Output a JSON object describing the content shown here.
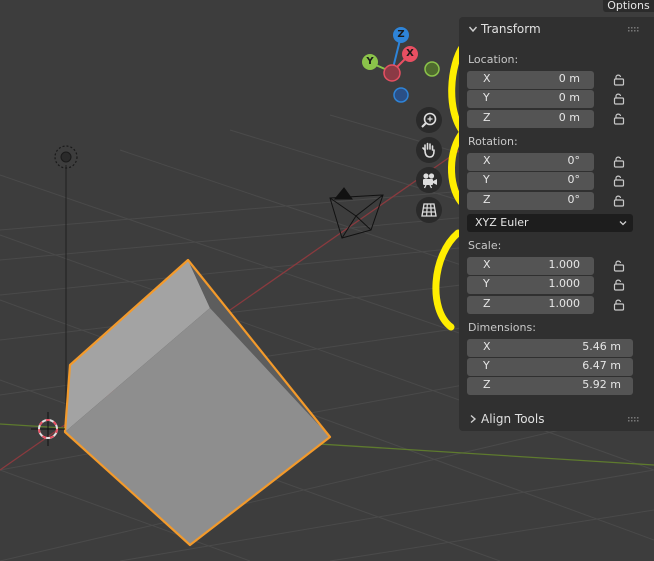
{
  "topbar": {
    "options_label": "Options"
  },
  "gizmo": {
    "x": "X",
    "y": "Y",
    "z": "Z"
  },
  "panel": {
    "transform": {
      "title": "Transform",
      "location": {
        "label": "Location:",
        "x_axis": "X",
        "x": "0 m",
        "y_axis": "Y",
        "y": "0 m",
        "z_axis": "Z",
        "z": "0 m"
      },
      "rotation": {
        "label": "Rotation:",
        "x_axis": "X",
        "x": "0°",
        "y_axis": "Y",
        "y": "0°",
        "z_axis": "Z",
        "z": "0°",
        "mode": "XYZ Euler"
      },
      "scale": {
        "label": "Scale:",
        "x_axis": "X",
        "x": "1.000",
        "y_axis": "Y",
        "y": "1.000",
        "z_axis": "Z",
        "z": "1.000"
      },
      "dimensions": {
        "label": "Dimensions:",
        "x_axis": "X",
        "x": "5.46 m",
        "y_axis": "Y",
        "y": "6.47 m",
        "z_axis": "Z",
        "z": "5.92 m"
      }
    },
    "align_tools": {
      "title": "Align Tools"
    }
  },
  "colors": {
    "viewport_bg": "#3d3d3d",
    "panel_bg": "#303030",
    "field_bg": "#545454",
    "selection_outline": "#f39a2b",
    "highlight_annotation": "#ffee00",
    "axis_x": "#e84f62",
    "axis_y": "#8bc34a",
    "axis_z": "#2e84d8"
  },
  "icons": [
    "zoom-icon",
    "pan-hand-icon",
    "camera-view-icon",
    "ortho-grid-icon",
    "lock-icon",
    "chevron-down-icon",
    "chevron-right-icon",
    "grip-icon",
    "3d-cursor-icon",
    "light-icon",
    "camera-object-icon"
  ]
}
